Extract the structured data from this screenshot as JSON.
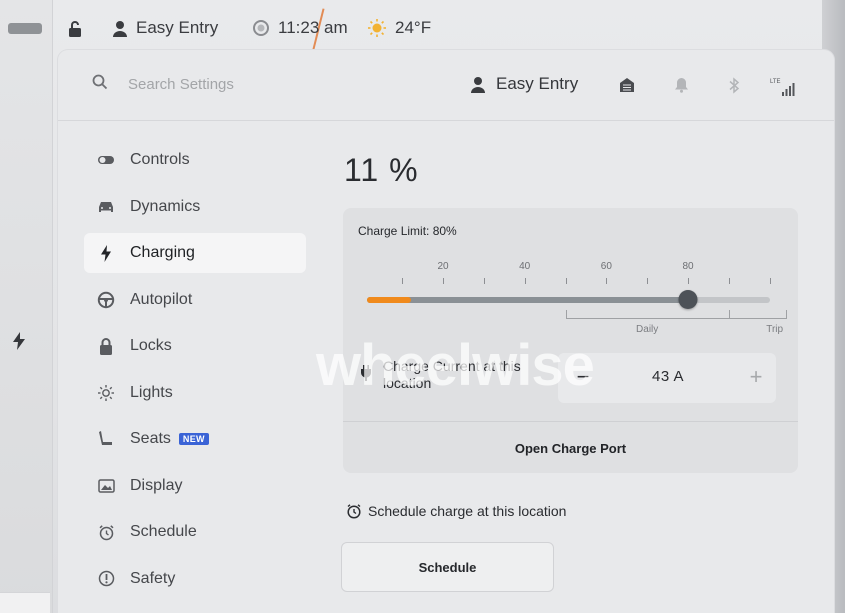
{
  "status_bar": {
    "profile_name": "Easy Entry",
    "time": "11:23 am",
    "temperature": "24°F"
  },
  "header": {
    "search_placeholder": "Search Settings",
    "profile_name": "Easy Entry",
    "signal_label": "LTE"
  },
  "sidebar": {
    "items": [
      {
        "label": "Controls",
        "icon": "toggle-icon"
      },
      {
        "label": "Dynamics",
        "icon": "car-icon"
      },
      {
        "label": "Charging",
        "icon": "bolt-icon",
        "active": true
      },
      {
        "label": "Autopilot",
        "icon": "steering-wheel-icon"
      },
      {
        "label": "Locks",
        "icon": "lock-icon"
      },
      {
        "label": "Lights",
        "icon": "sun-icon"
      },
      {
        "label": "Seats",
        "icon": "seat-icon",
        "badge": "NEW"
      },
      {
        "label": "Display",
        "icon": "display-icon"
      },
      {
        "label": "Schedule",
        "icon": "alarm-clock-icon"
      },
      {
        "label": "Safety",
        "icon": "safety-icon"
      }
    ]
  },
  "charging": {
    "battery_percent": "11 %",
    "battery_level": 0.11,
    "charge_limit_label": "Charge Limit: 80%",
    "charge_limit_value": 80,
    "slider_ticks": [
      "20",
      "40",
      "60",
      "80"
    ],
    "range_daily": "Daily",
    "range_trip": "Trip",
    "charge_current_label": "Charge Current at this location",
    "charge_current_value": "43 A",
    "minus_label": "−",
    "plus_label": "+",
    "open_port_label": "Open Charge Port",
    "schedule_label": "Schedule charge at this location",
    "schedule_button": "Schedule"
  },
  "watermark": "wheelwise",
  "colors": {
    "accent_orange": "#f08a1c",
    "badge_blue": "#3a63d6",
    "thumb": "#4d5258"
  }
}
